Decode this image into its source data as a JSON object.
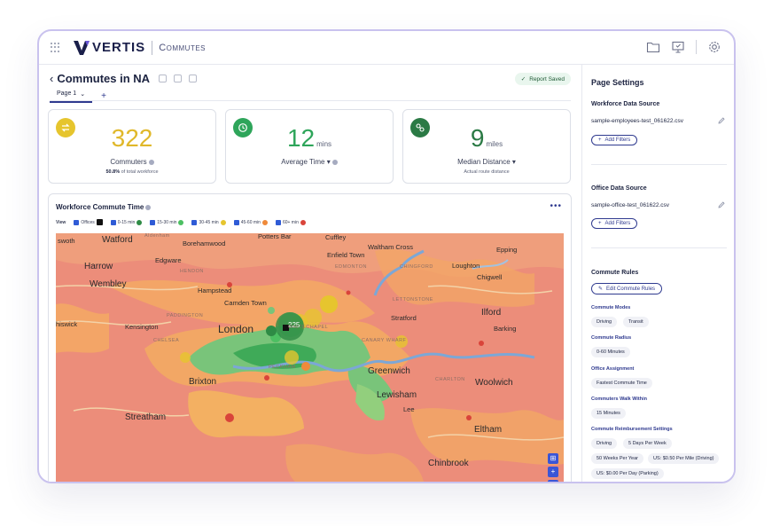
{
  "app": {
    "brand": "VERTIS",
    "product": "Commutes",
    "colors": {
      "accent": "#2f3a8f",
      "green": "#2b9a4a",
      "yellow": "#e6c52e"
    }
  },
  "report": {
    "back_icon": "chevron-left-icon",
    "title": "Commutes in NA",
    "saved_label": "Report Saved",
    "tabs": [
      {
        "label": "Page 1"
      }
    ],
    "add_tab": "+"
  },
  "metrics": [
    {
      "icon": "commute-arrows-icon",
      "color": "#e6c52e",
      "value": "322",
      "unit": "",
      "label": "Commuters",
      "sub_bold": "50.8%",
      "sub": " of total workforce"
    },
    {
      "icon": "clock-icon",
      "color": "#2ea55a",
      "value": "12",
      "unit": "mins",
      "label": "Average Time",
      "sub_bold": "",
      "sub": ""
    },
    {
      "icon": "route-icon",
      "color": "#2b7a45",
      "value": "9",
      "unit": "miles",
      "label": "Median Distance",
      "sub_bold": "",
      "sub": "Actual route distance"
    }
  ],
  "map": {
    "title": "Workforce Commute Time",
    "more": "•••",
    "legend_title": "View",
    "legend": [
      {
        "label": "Offices",
        "color": "#111111",
        "shape": "square"
      },
      {
        "label": "0-15 min",
        "color": "#2e8b45",
        "shape": "dot"
      },
      {
        "label": "15-30 min",
        "color": "#4cbf62",
        "shape": "dot"
      },
      {
        "label": "30-45 min",
        "color": "#e6c52e",
        "shape": "dot"
      },
      {
        "label": "45-60 min",
        "color": "#ef8a3a",
        "shape": "dot"
      },
      {
        "label": "60+ min",
        "color": "#d9443a",
        "shape": "dot"
      }
    ],
    "places": [
      {
        "name": "swoth",
        "cls": ""
      },
      {
        "name": "Watford",
        "cls": "big"
      },
      {
        "name": "Aldenham",
        "cls": "faint"
      },
      {
        "name": "Borehamwood",
        "cls": ""
      },
      {
        "name": "Potters Bar",
        "cls": ""
      },
      {
        "name": "Cuffley",
        "cls": ""
      },
      {
        "name": "Waltham Cross",
        "cls": ""
      },
      {
        "name": "Epping",
        "cls": ""
      },
      {
        "name": "Harrow",
        "cls": ""
      },
      {
        "name": "Edgware",
        "cls": ""
      },
      {
        "name": "Enfield Town",
        "cls": ""
      },
      {
        "name": "Loughton",
        "cls": ""
      },
      {
        "name": "Wembley",
        "cls": ""
      },
      {
        "name": "Chigwell",
        "cls": ""
      },
      {
        "name": "Hampstead",
        "cls": ""
      },
      {
        "name": "Camden Town",
        "cls": ""
      },
      {
        "name": "Stratford",
        "cls": ""
      },
      {
        "name": "Ilford",
        "cls": "big"
      },
      {
        "name": "hiswick",
        "cls": ""
      },
      {
        "name": "Kensington",
        "cls": ""
      },
      {
        "name": "London",
        "cls": "city"
      },
      {
        "name": "Barking",
        "cls": ""
      },
      {
        "name": "Greenwich",
        "cls": "big"
      },
      {
        "name": "Brixton",
        "cls": "big"
      },
      {
        "name": "Woolwich",
        "cls": "big"
      },
      {
        "name": "Lewisham",
        "cls": "big"
      },
      {
        "name": "Streatham",
        "cls": "big"
      },
      {
        "name": "Lee",
        "cls": ""
      },
      {
        "name": "Eltham",
        "cls": "big"
      },
      {
        "name": "Chinbrook",
        "cls": "big"
      },
      {
        "name": "HENDON",
        "cls": "faint"
      },
      {
        "name": "EDMONTON",
        "cls": "faint"
      },
      {
        "name": "CHINGFORD",
        "cls": "faint"
      },
      {
        "name": "PADDINGTON",
        "cls": "faint"
      },
      {
        "name": "WHITECHAPEL",
        "cls": "faint"
      },
      {
        "name": "CHELSEA",
        "cls": "faint"
      },
      {
        "name": "PECKHAM",
        "cls": "faint"
      },
      {
        "name": "CANARY WHARF",
        "cls": "faint"
      },
      {
        "name": "CHARLTON",
        "cls": "faint"
      },
      {
        "name": "LETTONSTONE",
        "cls": "faint"
      }
    ],
    "office_count": "225",
    "zoom_in": "+",
    "zoom_out": "−"
  },
  "sidebar": {
    "title": "Page Settings",
    "workforce": {
      "title": "Workforce Data Source",
      "file": "sample-employees-test_061622.csv",
      "add_filters": "Add Filters"
    },
    "office": {
      "title": "Office Data Source",
      "file": "sample-office-test_061622.csv",
      "add_filters": "Add Filters"
    },
    "rules": {
      "title": "Commute Rules",
      "edit": "Edit Commute Rules",
      "modes_label": "Commute Modes",
      "modes": [
        "Driving",
        "Transit"
      ],
      "radius_label": "Commute Radius",
      "radius": "0-60 Minutes",
      "assignment_label": "Office Assignment",
      "assignment": "Fastest Commute Time",
      "walk_label": "Commuters Walk Within",
      "walk": "15 Minutes",
      "reimb_label": "Commute Reimbursement Settings",
      "reimb": [
        "Driving",
        "5 Days Per Week",
        "50 Weeks Per Year",
        "US: $0.50 Per Mile (Driving)",
        "US: $0.00 Per Day (Parking)"
      ]
    }
  }
}
